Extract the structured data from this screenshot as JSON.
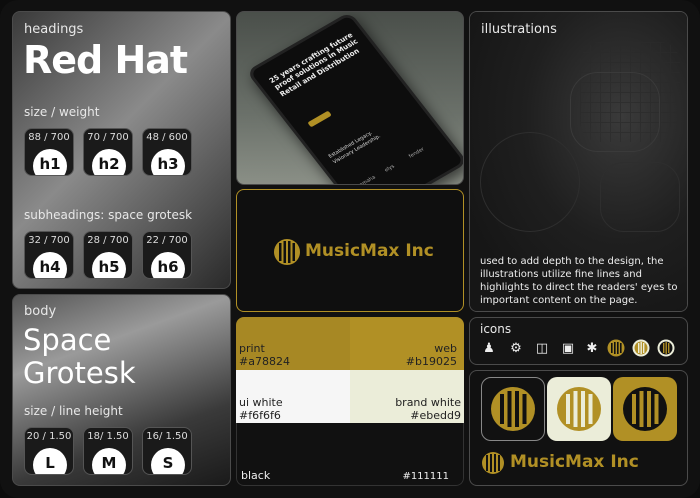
{
  "headings": {
    "section_label": "headings",
    "font_name": "Red Hat",
    "size_weight_label": "size / weight",
    "chips": [
      {
        "meta": "88 / 700",
        "tag": "h1"
      },
      {
        "meta": "70 / 700",
        "tag": "h2"
      },
      {
        "meta": "48 / 600",
        "tag": "h3"
      }
    ],
    "subheadings_label": "subheadings: space grotesk",
    "sub_chips": [
      {
        "meta": "32 / 700",
        "tag": "h4"
      },
      {
        "meta": "28 / 700",
        "tag": "h5"
      },
      {
        "meta": "22 / 700",
        "tag": "h6"
      }
    ]
  },
  "body": {
    "section_label": "body",
    "font_name_line1": "Space",
    "font_name_line2": "Grotesk",
    "size_line_label": "size / line height",
    "chips": [
      {
        "meta": "20 / 1.50",
        "tag": "L"
      },
      {
        "meta": "18/ 1.50",
        "tag": "M"
      },
      {
        "meta": "16/ 1.50",
        "tag": "S"
      }
    ]
  },
  "mockup": {
    "headline": "25 years crafting future proof solutions in Music Retail and Distribution",
    "tagline": "Established Legacy. Visionary Leadership.",
    "brand_marks": [
      "yamaha",
      "elys",
      "fender"
    ]
  },
  "logo_card": {
    "brand_name": "MusicMax Inc"
  },
  "illustrations": {
    "section_label": "illustrations",
    "description": "used to add depth to the design, the illustrations utilize fine lines and highlights to direct the readers' eyes to important content on the page."
  },
  "colors": {
    "print": {
      "label": "print",
      "hex": "#a78824"
    },
    "web": {
      "label": "web",
      "hex": "#b19025"
    },
    "ui_white": {
      "label": "ui white",
      "hex": "#f6f6f6"
    },
    "brand_white": {
      "label": "brand white",
      "hex": "#ebedd9"
    },
    "black": {
      "label": "black",
      "hex": "#111111"
    }
  },
  "icons": {
    "section_label": "icons",
    "items": [
      "people-group-icon",
      "gear-search-icon",
      "toolbox-icon",
      "monitor-settings-icon",
      "network-icon",
      "logo-coin-dark-icon",
      "logo-coin-white-icon",
      "logo-coin-gold-icon"
    ]
  },
  "logo_variants": {
    "brand_name": "MusicMax Inc"
  },
  "accent": "#b19025"
}
